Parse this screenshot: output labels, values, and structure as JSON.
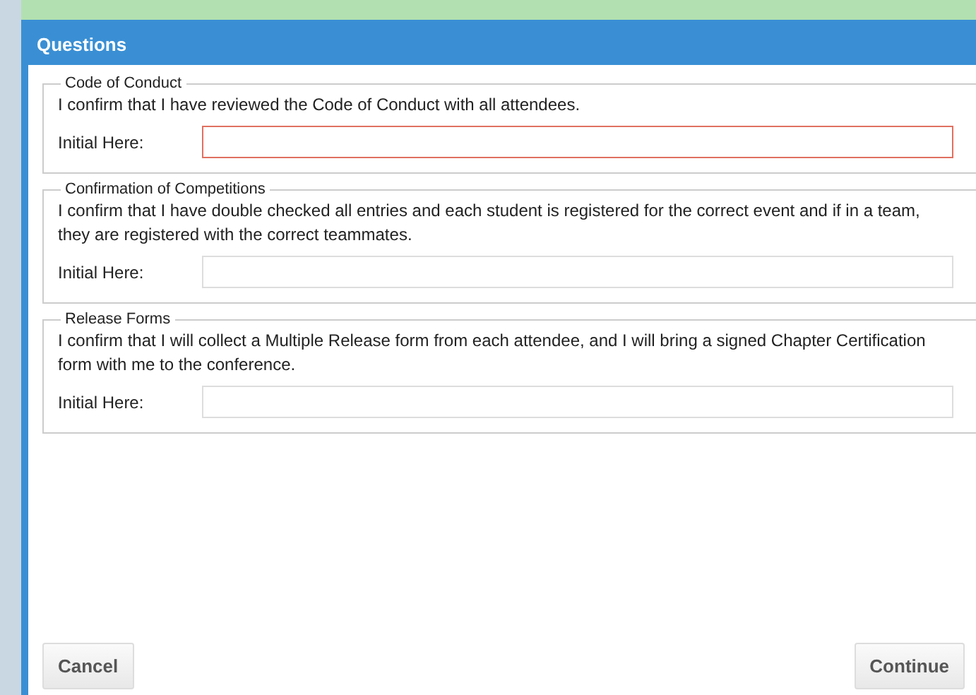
{
  "dialog": {
    "title": "Questions"
  },
  "sections": [
    {
      "legend": "Code of Conduct",
      "statement": "I confirm that I have reviewed the Code of Conduct with all attendees.",
      "field_label": "Initial Here:",
      "invalid": true
    },
    {
      "legend": "Confirmation of Competitions",
      "statement": "I confirm that I have double checked all entries and each student is registered for the correct event and if in a team, they are registered with the correct teammates.",
      "field_label": "Initial Here:",
      "invalid": false
    },
    {
      "legend": "Release Forms",
      "statement": "I confirm that I will collect a Multiple Release form from each attendee, and I will bring a signed Chapter Certification form with me to the conference.",
      "field_label": "Initial Here:",
      "invalid": false
    }
  ],
  "buttons": [
    {
      "label": "Cancel",
      "kind": "cancel"
    },
    {
      "label": "Continue",
      "kind": "continue"
    }
  ]
}
